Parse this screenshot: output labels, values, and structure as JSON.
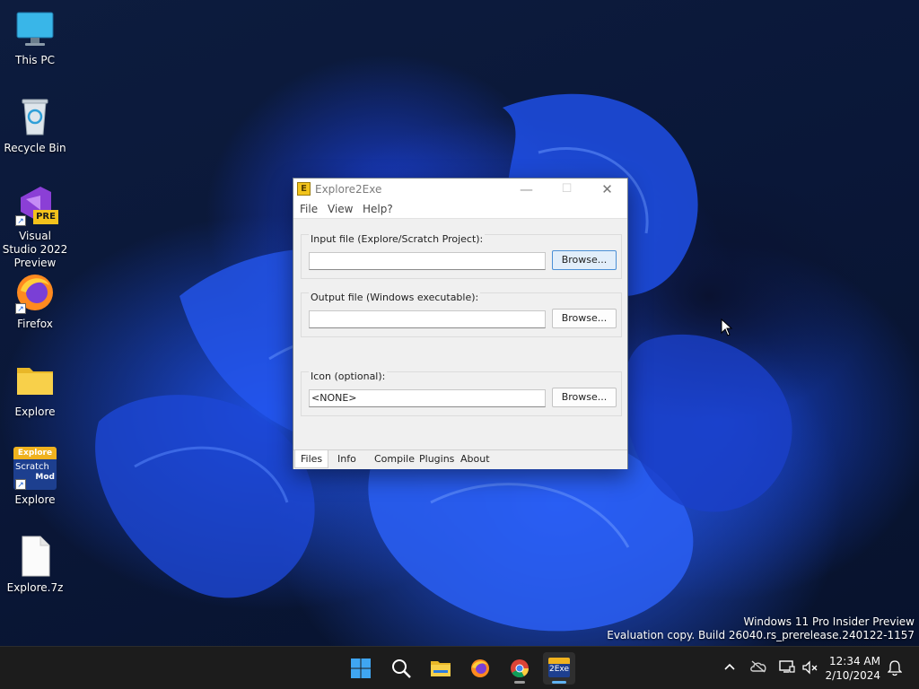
{
  "desktop": {
    "icons": [
      {
        "label": "This PC",
        "icon": "monitor-icon"
      },
      {
        "label": "Recycle Bin",
        "icon": "recycle-bin-icon"
      },
      {
        "label": "Visual Studio 2022 Preview",
        "icon": "visual-studio-icon",
        "badge": "PRE"
      },
      {
        "label": "Firefox",
        "icon": "firefox-icon"
      },
      {
        "label": "Explore",
        "icon": "folder-icon"
      },
      {
        "label": "Explore",
        "icon": "explore-scratch-icon",
        "logo_text": [
          "Explore",
          "Scratch",
          "Mod"
        ]
      },
      {
        "label": "Explore.7z",
        "icon": "file-icon"
      }
    ]
  },
  "window": {
    "title": "Explore2Exe",
    "app_icon_letter": "E",
    "menu": [
      "File",
      "View",
      "Help?"
    ],
    "caption": {
      "minimize": "—",
      "maximize": "☐",
      "close": "✕"
    },
    "input_group": {
      "label": "Input file (Explore/Scratch Project):",
      "value": "",
      "button": "Browse..."
    },
    "output_group": {
      "label": "Output file (Windows executable):",
      "value": "",
      "button": "Browse..."
    },
    "icon_group": {
      "label": "Icon (optional):",
      "value": "<NONE>",
      "button": "Browse..."
    },
    "tabs": [
      "Files",
      "Info",
      "Compile",
      "Plugins",
      "About"
    ],
    "active_tab": "Files"
  },
  "watermark": {
    "line1": "Windows 11 Pro Insider Preview",
    "line2": "Evaluation copy. Build 26040.rs_prerelease.240122-1157"
  },
  "taskbar": {
    "apps": [
      "start-icon",
      "search-icon",
      "file-explorer-icon",
      "firefox-icon",
      "chrome-icon",
      "explore2exe-icon"
    ],
    "active_app_label": "2Exe",
    "clock": {
      "time": "12:34 AM",
      "date": "2/10/2024"
    }
  },
  "colors": {
    "accent": "#4a8fd6",
    "taskbar": "#1c1c1c",
    "window": "#f0f0f0"
  }
}
